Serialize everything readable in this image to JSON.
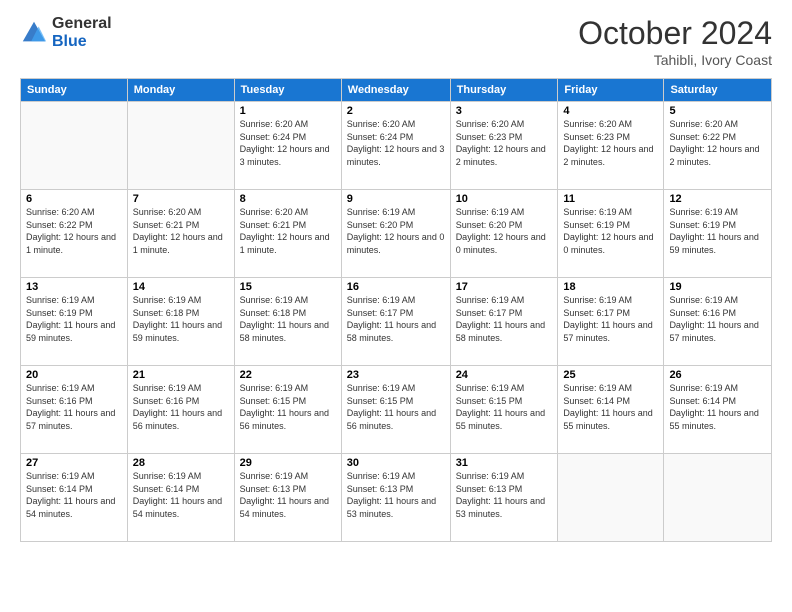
{
  "logo": {
    "general": "General",
    "blue": "Blue"
  },
  "header": {
    "month": "October 2024",
    "location": "Tahibli, Ivory Coast"
  },
  "weekdays": [
    "Sunday",
    "Monday",
    "Tuesday",
    "Wednesday",
    "Thursday",
    "Friday",
    "Saturday"
  ],
  "weeks": [
    [
      {
        "day": "",
        "info": ""
      },
      {
        "day": "",
        "info": ""
      },
      {
        "day": "1",
        "info": "Sunrise: 6:20 AM\nSunset: 6:24 PM\nDaylight: 12 hours and 3 minutes."
      },
      {
        "day": "2",
        "info": "Sunrise: 6:20 AM\nSunset: 6:24 PM\nDaylight: 12 hours and 3 minutes."
      },
      {
        "day": "3",
        "info": "Sunrise: 6:20 AM\nSunset: 6:23 PM\nDaylight: 12 hours and 2 minutes."
      },
      {
        "day": "4",
        "info": "Sunrise: 6:20 AM\nSunset: 6:23 PM\nDaylight: 12 hours and 2 minutes."
      },
      {
        "day": "5",
        "info": "Sunrise: 6:20 AM\nSunset: 6:22 PM\nDaylight: 12 hours and 2 minutes."
      }
    ],
    [
      {
        "day": "6",
        "info": "Sunrise: 6:20 AM\nSunset: 6:22 PM\nDaylight: 12 hours and 1 minute."
      },
      {
        "day": "7",
        "info": "Sunrise: 6:20 AM\nSunset: 6:21 PM\nDaylight: 12 hours and 1 minute."
      },
      {
        "day": "8",
        "info": "Sunrise: 6:20 AM\nSunset: 6:21 PM\nDaylight: 12 hours and 1 minute."
      },
      {
        "day": "9",
        "info": "Sunrise: 6:19 AM\nSunset: 6:20 PM\nDaylight: 12 hours and 0 minutes."
      },
      {
        "day": "10",
        "info": "Sunrise: 6:19 AM\nSunset: 6:20 PM\nDaylight: 12 hours and 0 minutes."
      },
      {
        "day": "11",
        "info": "Sunrise: 6:19 AM\nSunset: 6:19 PM\nDaylight: 12 hours and 0 minutes."
      },
      {
        "day": "12",
        "info": "Sunrise: 6:19 AM\nSunset: 6:19 PM\nDaylight: 11 hours and 59 minutes."
      }
    ],
    [
      {
        "day": "13",
        "info": "Sunrise: 6:19 AM\nSunset: 6:19 PM\nDaylight: 11 hours and 59 minutes."
      },
      {
        "day": "14",
        "info": "Sunrise: 6:19 AM\nSunset: 6:18 PM\nDaylight: 11 hours and 59 minutes."
      },
      {
        "day": "15",
        "info": "Sunrise: 6:19 AM\nSunset: 6:18 PM\nDaylight: 11 hours and 58 minutes."
      },
      {
        "day": "16",
        "info": "Sunrise: 6:19 AM\nSunset: 6:17 PM\nDaylight: 11 hours and 58 minutes."
      },
      {
        "day": "17",
        "info": "Sunrise: 6:19 AM\nSunset: 6:17 PM\nDaylight: 11 hours and 58 minutes."
      },
      {
        "day": "18",
        "info": "Sunrise: 6:19 AM\nSunset: 6:17 PM\nDaylight: 11 hours and 57 minutes."
      },
      {
        "day": "19",
        "info": "Sunrise: 6:19 AM\nSunset: 6:16 PM\nDaylight: 11 hours and 57 minutes."
      }
    ],
    [
      {
        "day": "20",
        "info": "Sunrise: 6:19 AM\nSunset: 6:16 PM\nDaylight: 11 hours and 57 minutes."
      },
      {
        "day": "21",
        "info": "Sunrise: 6:19 AM\nSunset: 6:16 PM\nDaylight: 11 hours and 56 minutes."
      },
      {
        "day": "22",
        "info": "Sunrise: 6:19 AM\nSunset: 6:15 PM\nDaylight: 11 hours and 56 minutes."
      },
      {
        "day": "23",
        "info": "Sunrise: 6:19 AM\nSunset: 6:15 PM\nDaylight: 11 hours and 56 minutes."
      },
      {
        "day": "24",
        "info": "Sunrise: 6:19 AM\nSunset: 6:15 PM\nDaylight: 11 hours and 55 minutes."
      },
      {
        "day": "25",
        "info": "Sunrise: 6:19 AM\nSunset: 6:14 PM\nDaylight: 11 hours and 55 minutes."
      },
      {
        "day": "26",
        "info": "Sunrise: 6:19 AM\nSunset: 6:14 PM\nDaylight: 11 hours and 55 minutes."
      }
    ],
    [
      {
        "day": "27",
        "info": "Sunrise: 6:19 AM\nSunset: 6:14 PM\nDaylight: 11 hours and 54 minutes."
      },
      {
        "day": "28",
        "info": "Sunrise: 6:19 AM\nSunset: 6:14 PM\nDaylight: 11 hours and 54 minutes."
      },
      {
        "day": "29",
        "info": "Sunrise: 6:19 AM\nSunset: 6:13 PM\nDaylight: 11 hours and 54 minutes."
      },
      {
        "day": "30",
        "info": "Sunrise: 6:19 AM\nSunset: 6:13 PM\nDaylight: 11 hours and 53 minutes."
      },
      {
        "day": "31",
        "info": "Sunrise: 6:19 AM\nSunset: 6:13 PM\nDaylight: 11 hours and 53 minutes."
      },
      {
        "day": "",
        "info": ""
      },
      {
        "day": "",
        "info": ""
      }
    ]
  ]
}
